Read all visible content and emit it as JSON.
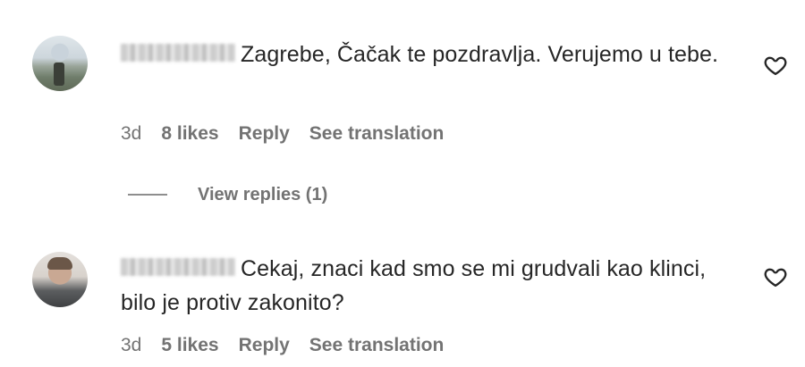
{
  "comments": [
    {
      "text": "Zagrebe, Čačak te pozdravlja. Verujemo u tebe.",
      "time": "3d",
      "likes": "8 likes",
      "reply": "Reply",
      "translate": "See translation",
      "view_replies": "View replies (1)"
    },
    {
      "text": "Cekaj, znaci kad smo se mi grudvali kao klinci, bilo je protiv zakonito?",
      "time": "3d",
      "likes": "5 likes",
      "reply": "Reply",
      "translate": "See translation"
    }
  ],
  "icons": {
    "like": "heart-outline-icon"
  },
  "colors": {
    "text": "#262626",
    "meta": "#737373"
  }
}
